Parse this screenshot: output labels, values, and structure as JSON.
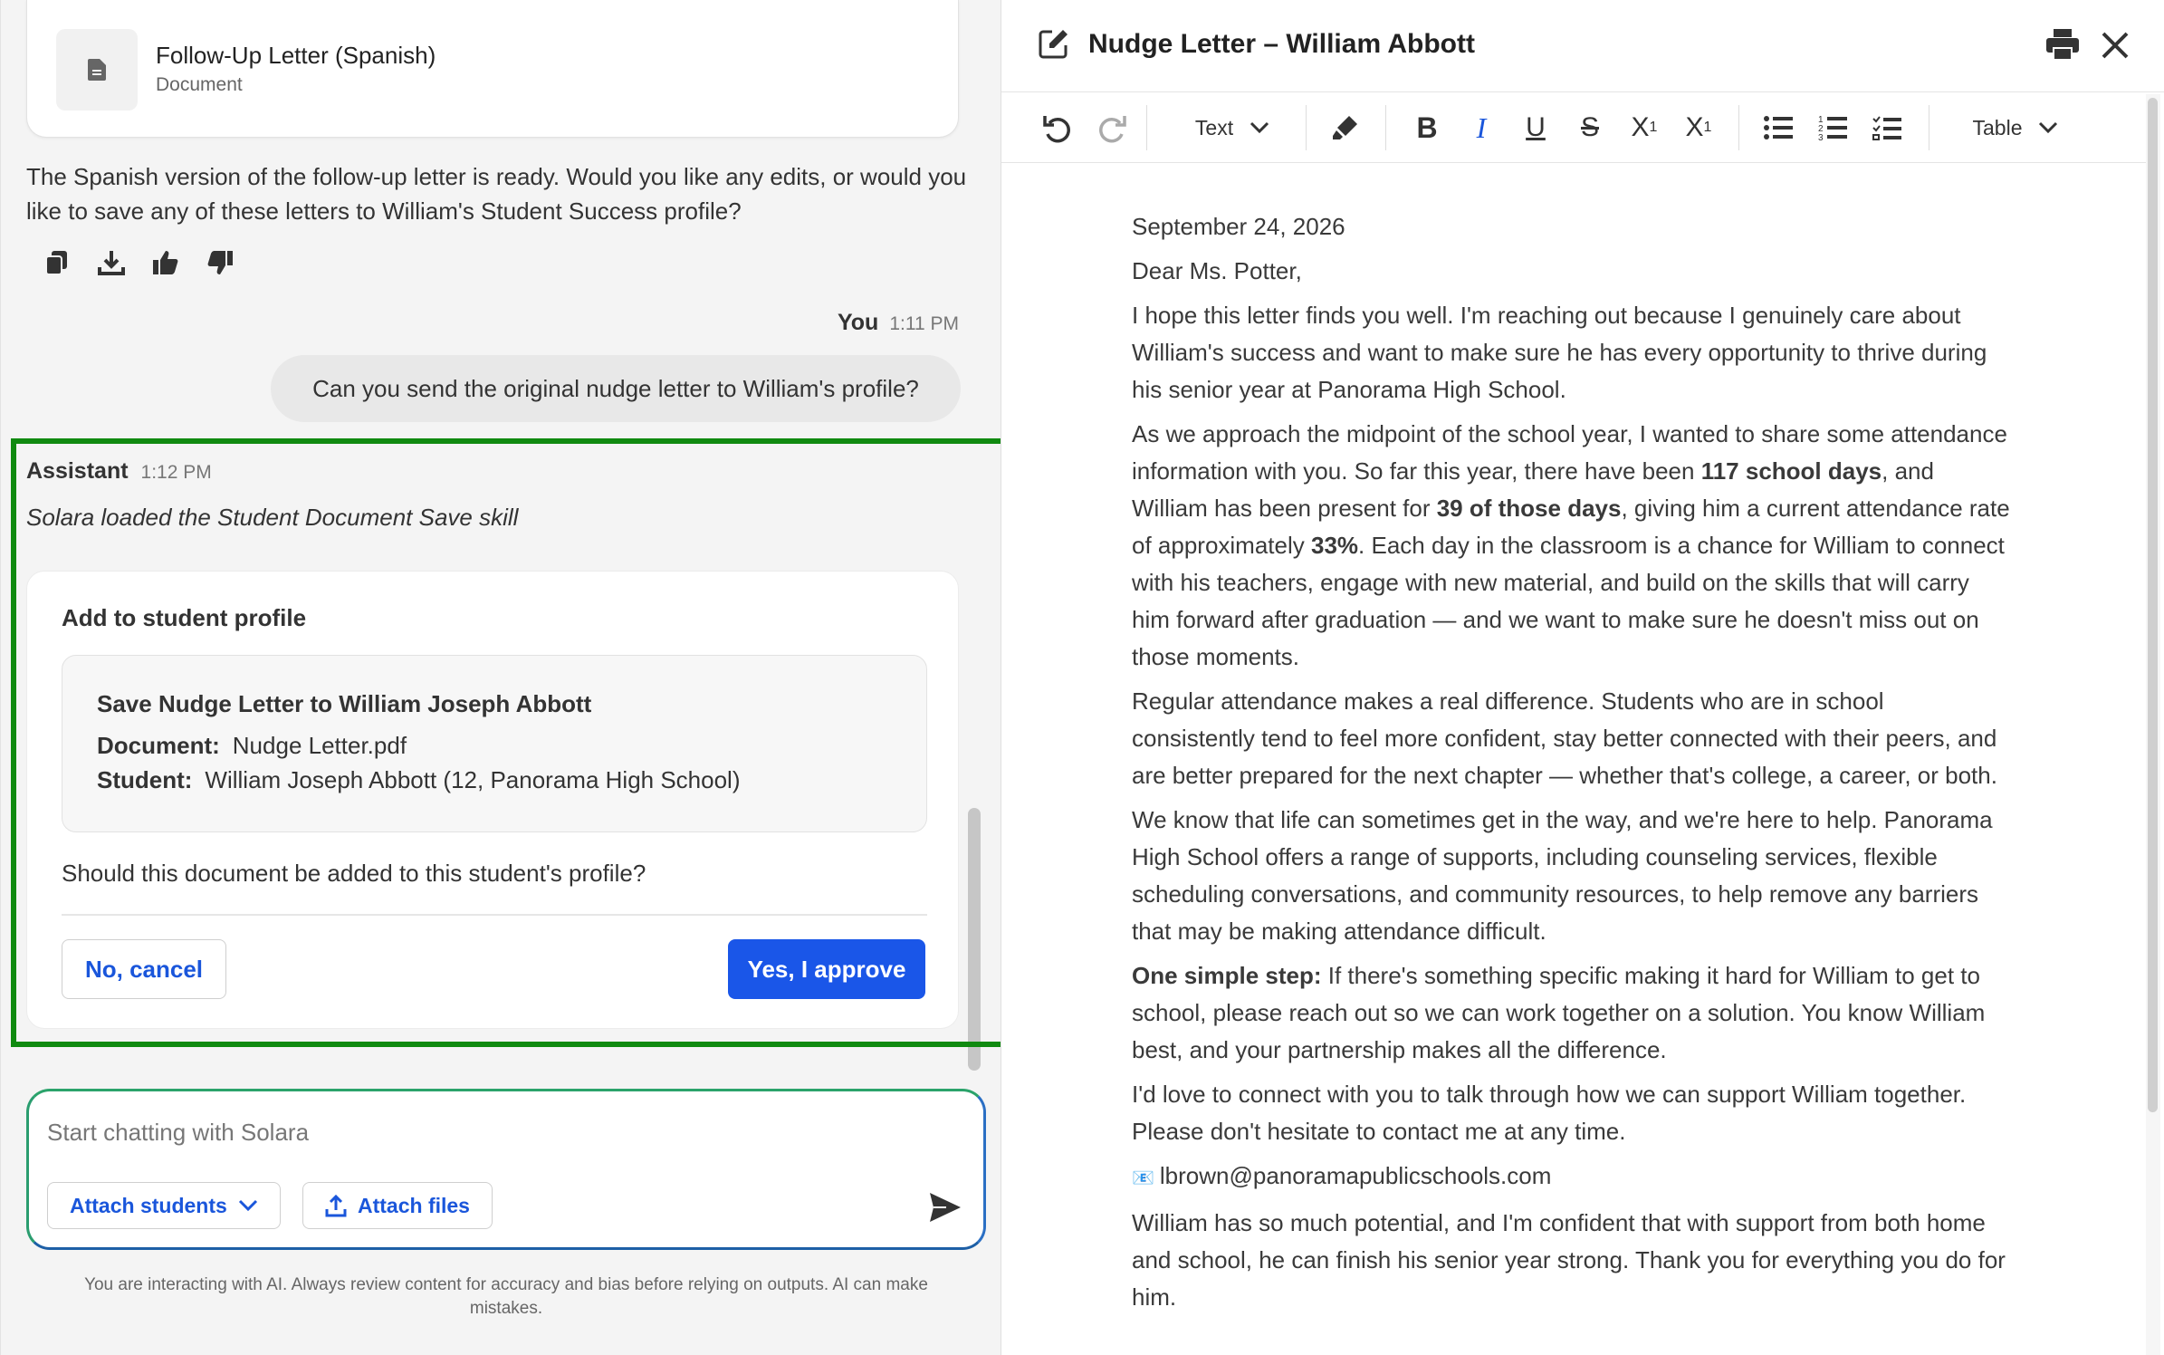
{
  "chat": {
    "doc_card": {
      "title": "Follow-Up Letter (Spanish)",
      "subtitle": "Document",
      "icon": "document-icon"
    },
    "assistant_message": "The Spanish version of the follow-up letter is ready. Would you like any edits, or would you like to save any of these letters to William's Student Success profile?",
    "user": {
      "name": "You",
      "time": "1:11 PM",
      "message": "Can you send the original nudge letter to William's profile?"
    },
    "assistant": {
      "name": "Assistant",
      "time": "1:12 PM",
      "status": "Solara loaded the Student Document Save skill"
    },
    "approval": {
      "title": "Add to student profile",
      "card_title": "Save Nudge Letter to William Joseph Abbott",
      "document_label": "Document:",
      "document_value": "Nudge Letter.pdf",
      "student_label": "Student:",
      "student_value": "William Joseph Abbott (12, Panorama High School)",
      "question": "Should this document be added to this student's profile?",
      "cancel_label": "No, cancel",
      "approve_label": "Yes, I approve"
    },
    "composer": {
      "placeholder": "Start chatting with Solara",
      "attach_students": "Attach students",
      "attach_files": "Attach files"
    },
    "disclaimer": "You are interacting with AI. Always review content for accuracy and bias before relying on outputs. AI can make mistakes."
  },
  "editor": {
    "title": "Nudge Letter – William Abbott",
    "toolbar": {
      "text_style": "Text",
      "table": "Table"
    },
    "date": "September 24, 2026",
    "greeting": "Dear Ms. Potter,",
    "p1": "I hope this letter finds you well. I'm reaching out because I genuinely care about William's success and want to make sure he has every opportunity to thrive during his senior year at Panorama High School.",
    "p2": {
      "a": "As we approach the midpoint of the school year, I wanted to share some attendance information with you. So far this year, there have been ",
      "b": "117 school days",
      "c": ", and William has been present for ",
      "d": "39 of those days",
      "e": ", giving him a current attendance rate of approximately ",
      "f": "33%",
      "g": ". Each day in the classroom is a chance for William to connect with his teachers, engage with new material, and build on the skills that will carry him forward after graduation — and we want to make sure he doesn't miss out on those moments."
    },
    "p3": "Regular attendance makes a real difference. Students who are in school consistently tend to feel more confident, stay better connected with their peers, and are better prepared for the next chapter — whether that's college, a career, or both.",
    "p4": "We know that life can sometimes get in the way, and we're here to help. Panorama High School offers a range of supports, including counseling services, flexible scheduling conversations, and community resources, to help remove any barriers that may be making attendance difficult.",
    "p5": {
      "lead": "One simple step:",
      "rest": " If there's something specific making it hard for William to get to school, please reach out so we can work together on a solution. You know William best, and your partnership makes all the difference."
    },
    "p6": "I'd love to connect with you to talk through how we can support William together. Please don't hesitate to contact me at any time.",
    "email_icon": "📧",
    "email": "lbrown@panoramapublicschools.com",
    "p7": "William has so much potential, and I'm confident that with support from both home and school, he can finish his senior year strong. Thank you for everything you do for him."
  },
  "colors": {
    "accent": "#1a56e8",
    "highlight": "#108a10"
  }
}
